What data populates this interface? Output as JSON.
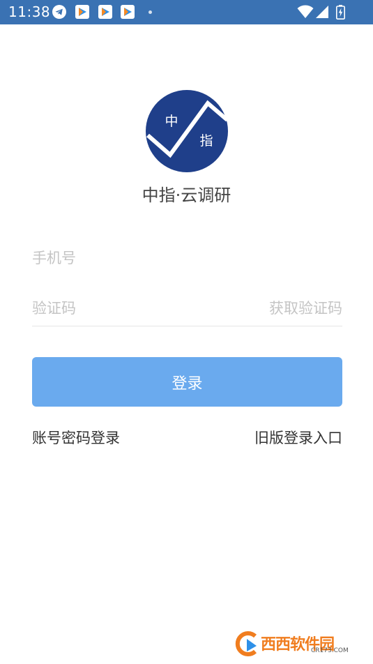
{
  "status_bar": {
    "time": "11:38",
    "icons": [
      "telegram-icon",
      "play-store-icon",
      "play-store-icon",
      "play-store-icon",
      "notification-dot-icon",
      "wifi-icon",
      "signal-icon",
      "battery-charging-icon"
    ],
    "background_color": "#3a72b3"
  },
  "logo": {
    "char_top": "中",
    "char_bottom": "指",
    "color": "#1f3f8a"
  },
  "app_name": "中指·云调研",
  "form": {
    "phone_placeholder": "手机号",
    "code_placeholder": "验证码",
    "get_code_label": "获取验证码",
    "login_label": "登录",
    "button_color": "#6aaaee"
  },
  "links": {
    "password_login": "账号密码登录",
    "old_version_login": "旧版登录入口"
  },
  "watermark": {
    "main": "西西软件园",
    "sub": "CR173.COM"
  }
}
